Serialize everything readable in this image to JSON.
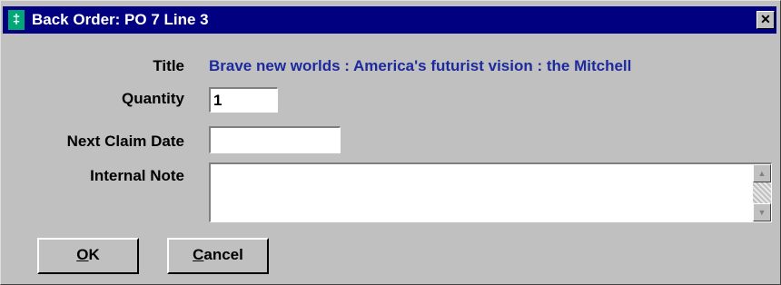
{
  "window": {
    "title": "Back Order: PO 7 Line 3",
    "app_icon_glyph": "‡",
    "close_glyph": "✕"
  },
  "form": {
    "title_label": "Title",
    "title_value": "Brave new worlds : America's futurist vision : the Mitchell",
    "quantity_label": "Quantity",
    "quantity_value": "1",
    "next_claim_date_label": "Next Claim Date",
    "next_claim_date_value": "",
    "internal_note_label": "Internal Note",
    "internal_note_value": ""
  },
  "scrollbar": {
    "up_glyph": "▲",
    "down_glyph": "▼"
  },
  "buttons": {
    "ok_mnemonic": "O",
    "ok_rest": "K",
    "cancel_mnemonic": "C",
    "cancel_rest": "ancel"
  },
  "colors": {
    "titlebar": "#000080",
    "title_value_text": "#1c2a9e",
    "dialog_background": "#c0c0c0"
  }
}
